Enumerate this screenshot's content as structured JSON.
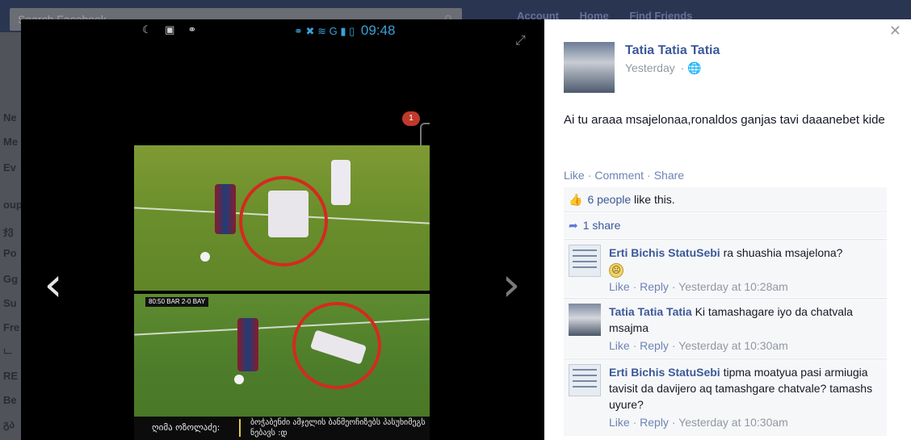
{
  "background": {
    "search_placeholder": "Search Facebook",
    "top_links": [
      "Account",
      "Home",
      "Find Friends"
    ],
    "sidebar_letters": [
      "Ne",
      "Me",
      "Ev",
      "oup",
      "ჯვ",
      "Po",
      "Gg",
      "Su",
      "Fre",
      "ட",
      "RE",
      "Be",
      "გა"
    ]
  },
  "photo": {
    "status_time": "09:48",
    "network": "G",
    "notification_count": "1",
    "score": "80:50  BAR 2-0 BAY",
    "caption_left": "ღიმა ოზოლაძე:",
    "caption_right": "ბოჭაბენძი ამჯელის ბანმეოჩიზებს პასუხიმეგს ნებავს :დ"
  },
  "post": {
    "author": "Tatia Tatia Tatia",
    "time": "Yesterday",
    "text": "Ai tu araaa msajelonaa,ronaldos ganjas tavi daaanebet kide",
    "actions": [
      "Like",
      "Comment",
      "Share"
    ],
    "likes_count": "6 people",
    "likes_suffix": " like this.",
    "shares": "1 share"
  },
  "comments": [
    {
      "author": "Erti Bichis StatuSebi",
      "text": "ra shuashia msajelona?",
      "like": "Like",
      "reply": "Reply",
      "time": "Yesterday at 10:28am"
    },
    {
      "author": "Tatia Tatia Tatia",
      "text": "Ki tamashagare iyo da chatvala msajma",
      "like": "Like",
      "reply": "Reply",
      "time": "Yesterday at 10:30am"
    },
    {
      "author": "Erti Bichis StatuSebi",
      "text": "tipma moatyua pasi armiugia tavisit da davijero aq tamashgare chatvale? tamashs uyure?",
      "like": "Like",
      "reply": "Reply",
      "time": "Yesterday at 10:30am"
    }
  ],
  "colors": {
    "link": "#3b5998",
    "action": "#6d84b4",
    "meta": "#9197a3",
    "circle": "#d42a1f"
  }
}
